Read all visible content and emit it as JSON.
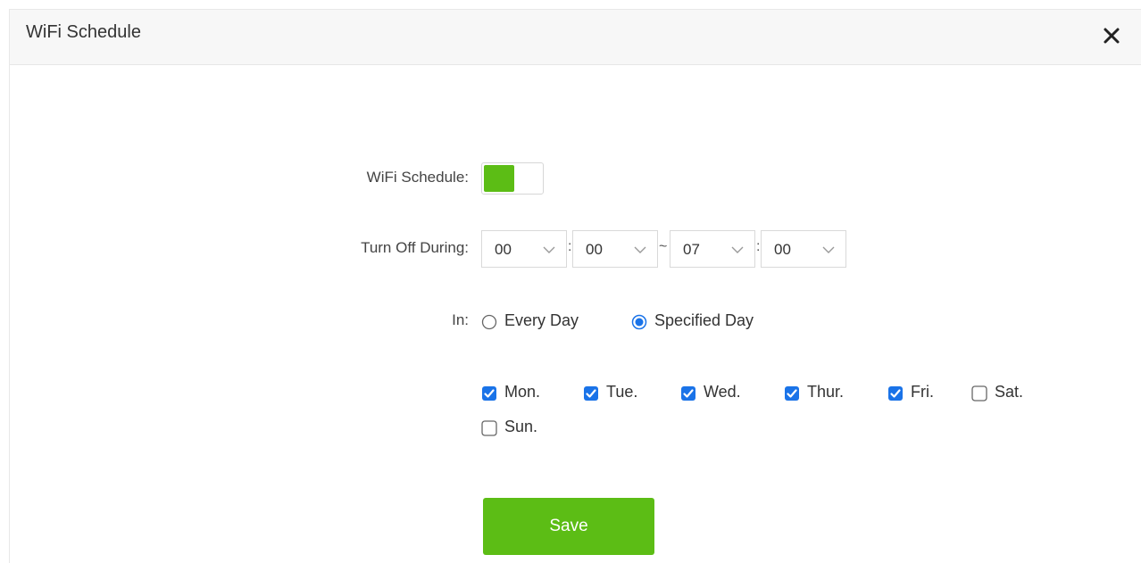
{
  "dialog": {
    "title": "WiFi Schedule",
    "close_icon": "close-icon"
  },
  "form": {
    "schedule_label": "WiFi Schedule:",
    "schedule_enabled": true,
    "turn_off_label": "Turn Off During:",
    "start_hour": "00",
    "start_minute": "00",
    "end_hour": "07",
    "end_minute": "00",
    "time_sep": ":",
    "range_sep": "~",
    "in_label": "In:",
    "every_day_label": "Every Day",
    "specified_day_label": "Specified Day",
    "selected_mode": "Specified Day",
    "days": [
      {
        "label": "Mon.",
        "checked": true
      },
      {
        "label": "Tue.",
        "checked": true
      },
      {
        "label": "Wed.",
        "checked": true
      },
      {
        "label": "Thur.",
        "checked": true
      },
      {
        "label": "Fri.",
        "checked": true
      },
      {
        "label": "Sat.",
        "checked": false
      },
      {
        "label": "Sun.",
        "checked": false
      }
    ],
    "save_label": "Save"
  },
  "colors": {
    "accent": "#5cbd15",
    "checkbox": "#1a73e8",
    "header_bg": "#f7f7f7"
  }
}
